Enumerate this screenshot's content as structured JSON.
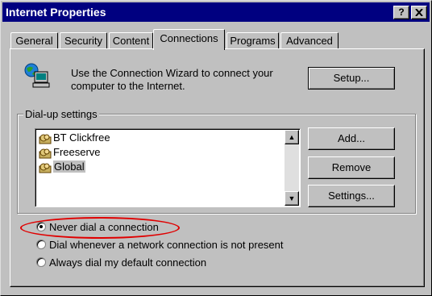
{
  "window": {
    "title": "Internet Properties"
  },
  "titlebar_buttons": {
    "help": "?",
    "close": "✕"
  },
  "tabs": [
    {
      "label": "General"
    },
    {
      "label": "Security"
    },
    {
      "label": "Content"
    },
    {
      "label": "Connections",
      "active": true
    },
    {
      "label": "Programs"
    },
    {
      "label": "Advanced"
    }
  ],
  "wizard": {
    "text_line1": "Use the Connection Wizard to connect your",
    "text_line2": "computer to the Internet.",
    "setup_label": "Setup...",
    "icon": "network-computer-icon"
  },
  "dialup": {
    "group_label": "Dial-up settings",
    "connections": [
      {
        "name": "BT Clickfree",
        "icon": "dialup-icon"
      },
      {
        "name": "Freeserve",
        "icon": "dialup-icon"
      },
      {
        "name": "Global",
        "icon": "dialup-icon",
        "selected": true
      }
    ],
    "buttons": {
      "add": "Add...",
      "remove": "Remove",
      "settings": "Settings..."
    }
  },
  "dial_options": {
    "never": "Never dial a connection",
    "whenever": "Dial whenever a network connection is not present",
    "always": "Always dial my default connection",
    "selected": "never"
  },
  "colors": {
    "titlebar": "#000080",
    "face": "#c0c0c0",
    "highlight_ellipse": "#e00000"
  }
}
